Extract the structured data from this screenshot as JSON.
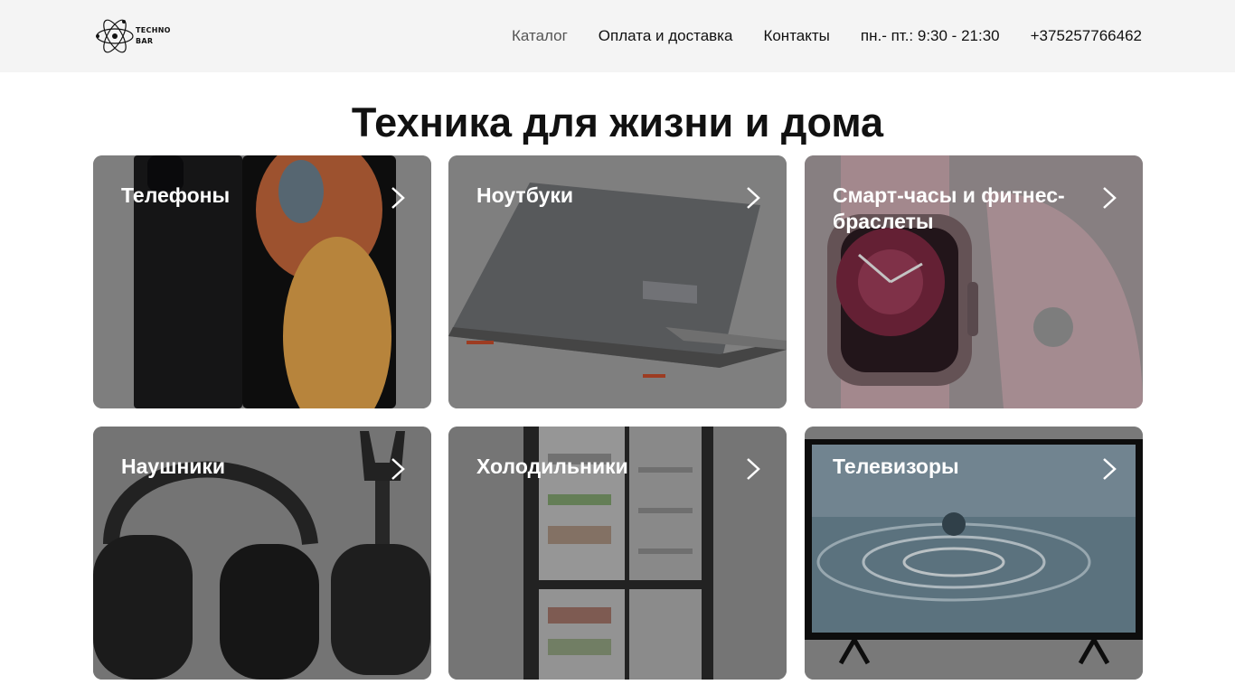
{
  "header": {
    "logo_line1": "TECHNO",
    "logo_line2": "BAR",
    "nav": [
      {
        "label": "Каталог"
      },
      {
        "label": "Оплата и доставка"
      },
      {
        "label": "Контакты"
      },
      {
        "label": "пн.- пт.: 9:30 - 21:30"
      },
      {
        "label": "+375257766462"
      }
    ]
  },
  "main": {
    "title": "Техника для жизни и дома",
    "categories": [
      {
        "label": "Телефоны",
        "icon": "chevron-right-icon"
      },
      {
        "label": "Ноутбуки",
        "icon": "chevron-right-icon"
      },
      {
        "label": "Смарт-часы и фитнес-браслеты",
        "icon": "chevron-right-icon"
      },
      {
        "label": "Наушники",
        "icon": "chevron-right-icon"
      },
      {
        "label": "Холодильники",
        "icon": "chevron-right-icon"
      },
      {
        "label": "Телевизоры",
        "icon": "chevron-right-icon"
      }
    ]
  },
  "colors": {
    "header_bg": "#f4f4f4",
    "card_overlay": "#8a8a8a",
    "text": "#111111",
    "card_text": "#ffffff"
  }
}
